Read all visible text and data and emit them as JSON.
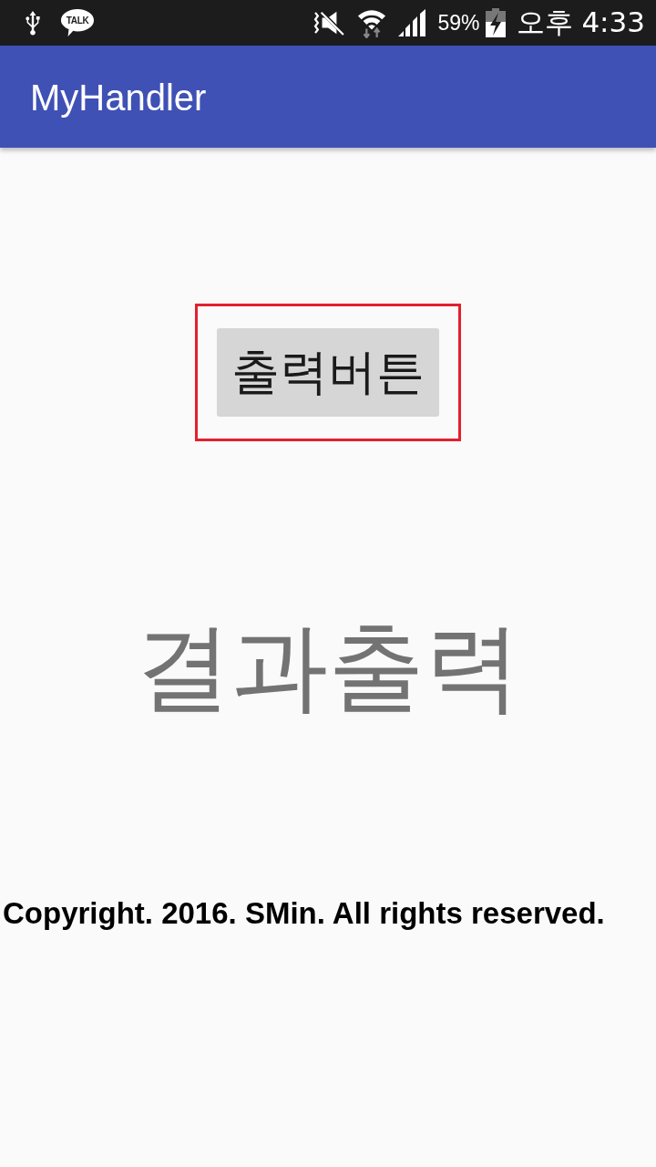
{
  "status_bar": {
    "chat_icon_label": "TALK",
    "battery_percent": "59%",
    "time": "오후 4:33"
  },
  "app_bar": {
    "title": "MyHandler"
  },
  "content": {
    "output_button": {
      "label": "출력버튼",
      "highlighted": true
    },
    "result_text": "결과출력",
    "copyright": "Copyright. 2016. SMin. All rights reserved."
  }
}
